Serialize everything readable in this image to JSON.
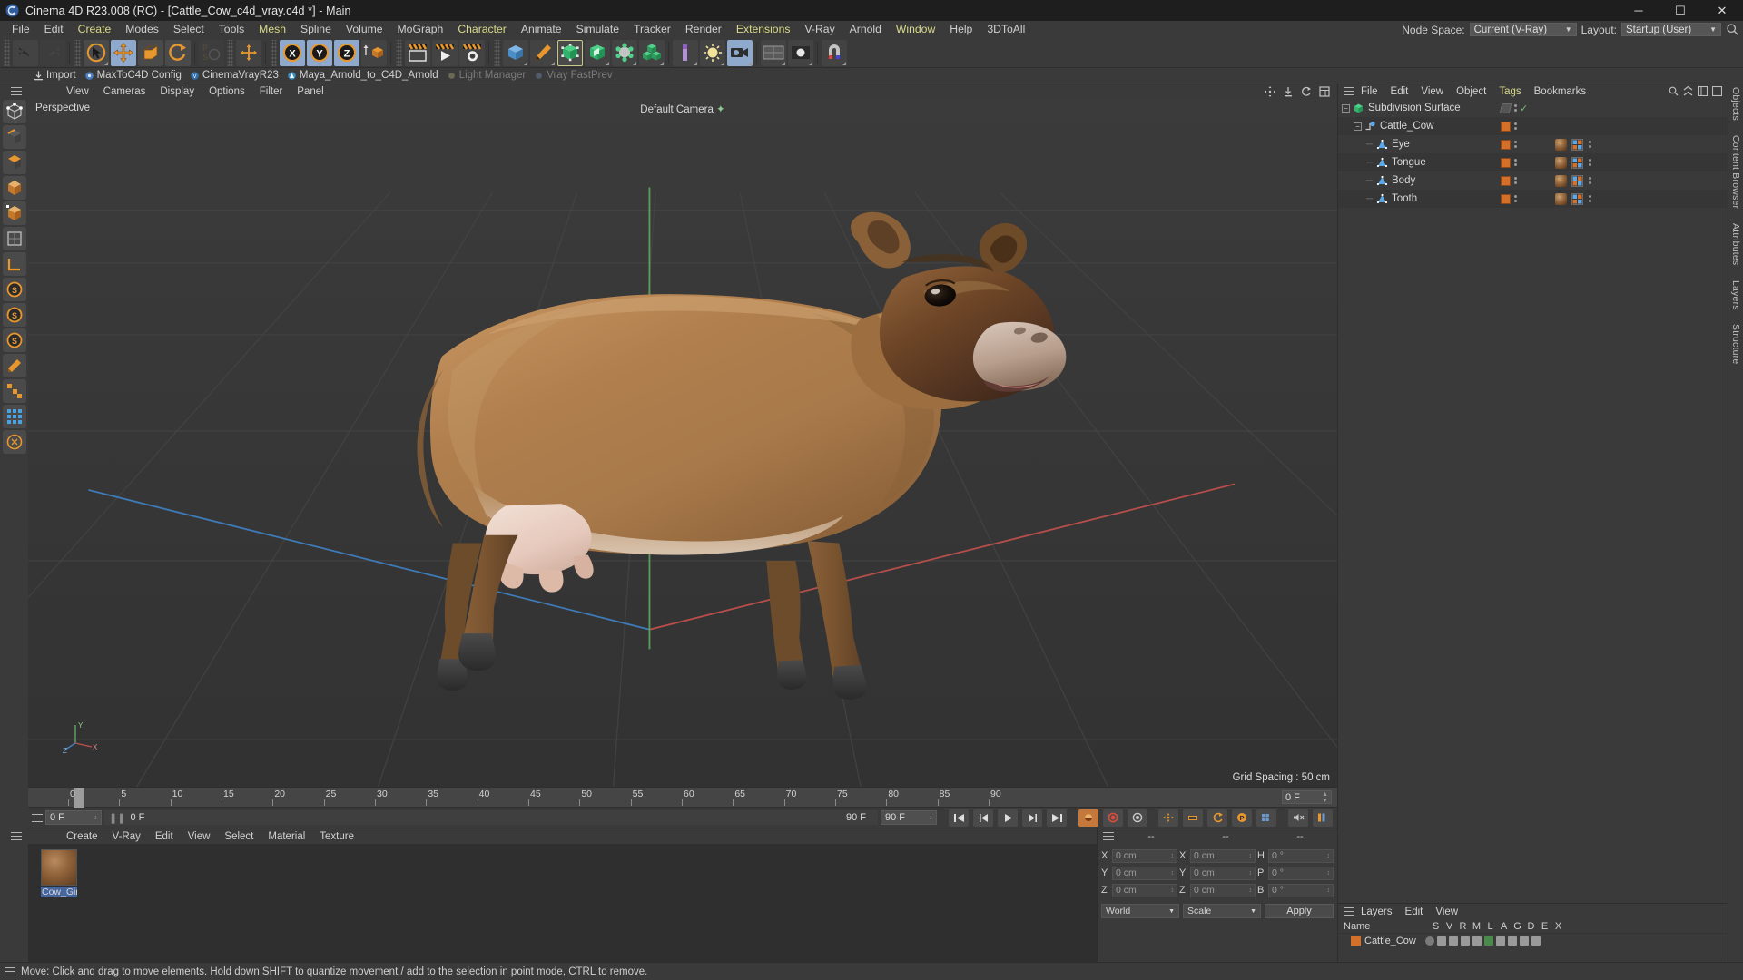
{
  "titlebar": {
    "title": "Cinema 4D R23.008 (RC) - [Cattle_Cow_c4d_vray.c4d *] - Main",
    "minimize": "─",
    "maximize": "☐",
    "close": "✕"
  },
  "menubar": {
    "items": [
      {
        "label": "File",
        "style": "gray"
      },
      {
        "label": "Edit",
        "style": "gray"
      },
      {
        "label": "Create",
        "style": "yellow"
      },
      {
        "label": "Modes",
        "style": "gray"
      },
      {
        "label": "Select",
        "style": "gray"
      },
      {
        "label": "Tools",
        "style": "gray"
      },
      {
        "label": "Mesh",
        "style": "yellow"
      },
      {
        "label": "Spline",
        "style": "gray"
      },
      {
        "label": "Volume",
        "style": "gray"
      },
      {
        "label": "MoGraph",
        "style": "gray"
      },
      {
        "label": "Character",
        "style": "yellow"
      },
      {
        "label": "Animate",
        "style": "gray"
      },
      {
        "label": "Simulate",
        "style": "gray"
      },
      {
        "label": "Tracker",
        "style": "gray"
      },
      {
        "label": "Render",
        "style": "gray"
      },
      {
        "label": "Extensions",
        "style": "yellow"
      },
      {
        "label": "V-Ray",
        "style": "gray"
      },
      {
        "label": "Arnold",
        "style": "gray"
      },
      {
        "label": "Window",
        "style": "yellow"
      },
      {
        "label": "Help",
        "style": "gray"
      },
      {
        "label": "3DToAll",
        "style": "gray"
      }
    ],
    "node_space_label": "Node Space:",
    "node_space_value": "Current (V-Ray)",
    "layout_label": "Layout:",
    "layout_value": "Startup (User)"
  },
  "pluginbar": {
    "items": [
      {
        "label": "Import",
        "dim": false
      },
      {
        "label": "MaxToC4D Config",
        "dim": false
      },
      {
        "label": "CinemaVrayR23",
        "dim": false
      },
      {
        "label": "Maya_Arnold_to_C4D_Arnold",
        "dim": false
      },
      {
        "label": "Light Manager",
        "dim": true
      },
      {
        "label": "Vray FastPrev",
        "dim": true
      }
    ]
  },
  "viewport": {
    "menu": [
      "View",
      "Cameras",
      "Display",
      "Options",
      "Filter",
      "Panel"
    ],
    "label_left": "Perspective",
    "label_camera": "Default Camera",
    "grid_spacing": "Grid Spacing : 50 cm",
    "axis": {
      "x": "X",
      "y": "Y",
      "z": "Z"
    }
  },
  "timeline": {
    "ticks": [
      "0",
      "5",
      "10",
      "15",
      "20",
      "25",
      "30",
      "35",
      "40",
      "45",
      "50",
      "55",
      "60",
      "65",
      "70",
      "75",
      "80",
      "85",
      "90"
    ],
    "current_field": "0 F"
  },
  "transport": {
    "current_frame": "0 F",
    "start_frame": "0 F",
    "end_label": "90 F",
    "end_field": "90 F"
  },
  "materials": {
    "menu": [
      "Create",
      "V-Ray",
      "Edit",
      "View",
      "Select",
      "Material",
      "Texture"
    ],
    "items": [
      {
        "name": "Cow_Gin"
      }
    ]
  },
  "coordinates": {
    "headers": [
      "--",
      "--",
      "--"
    ],
    "rows": [
      {
        "axis1": "X",
        "v1": "0 cm",
        "axis2": "X",
        "v2": "0 cm",
        "axis3": "H",
        "v3": "0 °"
      },
      {
        "axis1": "Y",
        "v1": "0 cm",
        "axis2": "Y",
        "v2": "0 cm",
        "axis3": "P",
        "v3": "0 °"
      },
      {
        "axis1": "Z",
        "v1": "0 cm",
        "axis2": "Z",
        "v2": "0 cm",
        "axis3": "B",
        "v3": "0 °"
      }
    ],
    "space": "World",
    "mode": "Scale",
    "apply": "Apply"
  },
  "objects": {
    "menu": [
      "File",
      "Edit",
      "View",
      "Object",
      "Tags",
      "Bookmarks"
    ],
    "rows": [
      {
        "label": "Subdivision Surface",
        "depth": 0,
        "icon": "subdivision-surface-icon",
        "expandable": true,
        "tag": "none"
      },
      {
        "label": "Cattle_Cow",
        "depth": 1,
        "icon": "null-object-icon",
        "expandable": true,
        "tag": "material"
      },
      {
        "label": "Eye",
        "depth": 2,
        "icon": "polygon-object-icon",
        "expandable": false,
        "tag": "material"
      },
      {
        "label": "Tongue",
        "depth": 2,
        "icon": "polygon-object-icon",
        "expandable": false,
        "tag": "material"
      },
      {
        "label": "Body",
        "depth": 2,
        "icon": "polygon-object-icon",
        "expandable": false,
        "tag": "material"
      },
      {
        "label": "Tooth",
        "depth": 2,
        "icon": "polygon-object-icon",
        "expandable": false,
        "tag": "material"
      }
    ]
  },
  "layers": {
    "menu": [
      "Layers",
      "Edit",
      "View"
    ],
    "name_header": "Name",
    "columns": [
      "S",
      "V",
      "R",
      "M",
      "L",
      "A",
      "G",
      "D",
      "E",
      "X"
    ],
    "rows": [
      {
        "name": "Cattle_Cow"
      }
    ]
  },
  "edge_tabs_right": [
    "Objects",
    "Content Browser",
    "Attributes",
    "Layers",
    "Structure"
  ],
  "statusbar": {
    "message": "Move: Click and drag to move elements. Hold down SHIFT to quantize movement / add to the selection in point mode, CTRL to remove."
  },
  "colors": {
    "accent_orange": "#d4702a",
    "highlight_blue": "#8fa9cc",
    "menu_yellow": "#d9d98a",
    "panel_bg": "#3a3a3a",
    "viewport_bg": "#363636"
  }
}
